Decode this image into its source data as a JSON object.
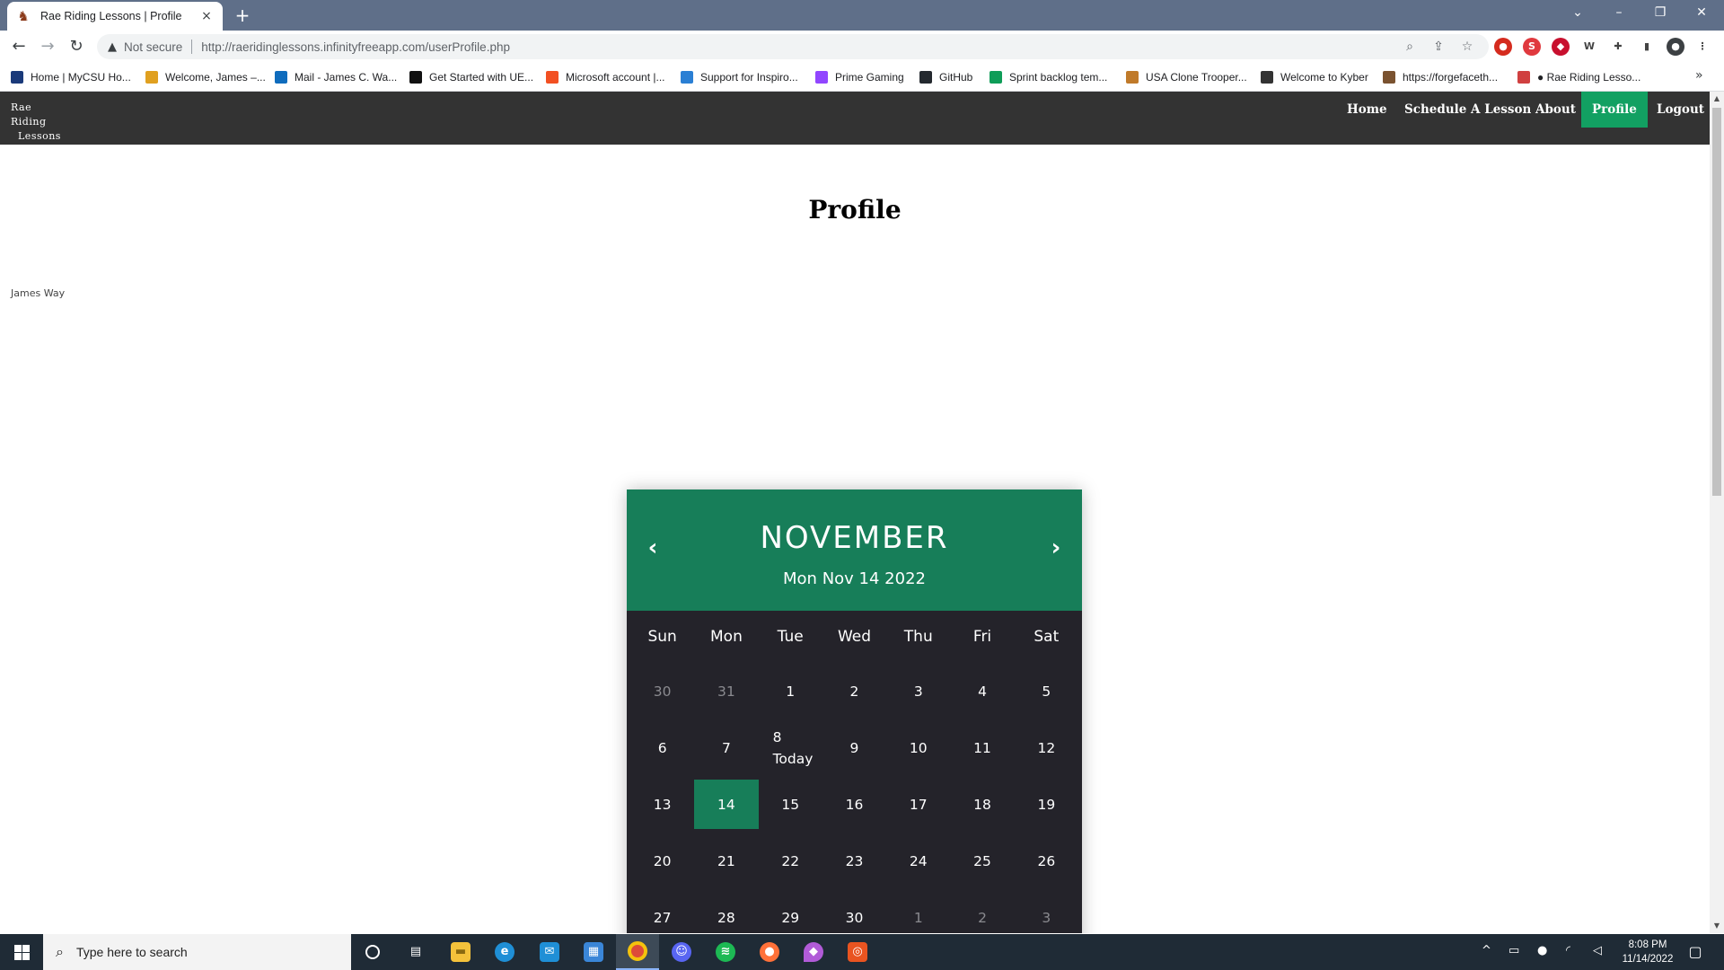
{
  "browser": {
    "tab_title": "Rae Riding Lessons | Profile",
    "tab_close": "×",
    "new_tab": "+",
    "not_secure": "Not secure",
    "url": "http://raeridinglessons.infinityfreeapp.com/userProfile.php",
    "bookmarks": [
      {
        "label": "Home | MyCSU Ho...",
        "icon": "mycsu-icon",
        "color": "#1a3a7a"
      },
      {
        "label": "Welcome, James –...",
        "icon": "pencil-icon",
        "color": "#e0a020"
      },
      {
        "label": "Mail - James C. Wa...",
        "icon": "outlook-icon",
        "color": "#0f6cbd"
      },
      {
        "label": "Get Started with UE...",
        "icon": "unreal-icon",
        "color": "#111111"
      },
      {
        "label": "Microsoft account |...",
        "icon": "microsoft-icon",
        "color": "#f25022"
      },
      {
        "label": "Support for Inspiro...",
        "icon": "dell-icon",
        "color": "#2a7fd4"
      },
      {
        "label": "Prime Gaming",
        "icon": "crown-icon",
        "color": "#9146ff"
      },
      {
        "label": "GitHub",
        "icon": "github-icon",
        "color": "#24292f"
      },
      {
        "label": "Sprint backlog tem...",
        "icon": "sheets-icon",
        "color": "#0f9d58"
      },
      {
        "label": "USA Clone Trooper...",
        "icon": "box-icon",
        "color": "#c07a2a"
      },
      {
        "label": "Welcome to Kyber",
        "icon": "kyber-icon",
        "color": "#333333"
      },
      {
        "label": "https://forgefaceth...",
        "icon": "bird-icon",
        "color": "#7a5230"
      },
      {
        "label": "● Rae Riding Lesso...",
        "icon": "dots-icon",
        "color": "#d04040"
      }
    ]
  },
  "site": {
    "logo_line1": "Rae Riding",
    "logo_line2": "Lessons",
    "nav": [
      {
        "label": "Home",
        "active": false
      },
      {
        "label": "Schedule A Lesson",
        "active": false
      },
      {
        "label": "About",
        "active": false
      },
      {
        "label": "Profile",
        "active": true
      },
      {
        "label": "Logout",
        "active": false
      }
    ]
  },
  "page": {
    "title": "Profile",
    "user_name": "James Way"
  },
  "calendar": {
    "month": "NOVEMBER",
    "date_line": "Mon Nov 14 2022",
    "prev_arrow": "‹",
    "next_arrow": "›",
    "weekdays": [
      "Sun",
      "Mon",
      "Tue",
      "Wed",
      "Thu",
      "Fri",
      "Sat"
    ],
    "today_label": "Today",
    "weeks": [
      [
        {
          "d": "30",
          "m": true
        },
        {
          "d": "31",
          "m": true
        },
        {
          "d": "1"
        },
        {
          "d": "2"
        },
        {
          "d": "3"
        },
        {
          "d": "4"
        },
        {
          "d": "5"
        }
      ],
      [
        {
          "d": "6"
        },
        {
          "d": "7"
        },
        {
          "d": "8",
          "today": true
        },
        {
          "d": "9"
        },
        {
          "d": "10"
        },
        {
          "d": "11"
        },
        {
          "d": "12"
        }
      ],
      [
        {
          "d": "13"
        },
        {
          "d": "14",
          "sel": true
        },
        {
          "d": "15"
        },
        {
          "d": "16"
        },
        {
          "d": "17"
        },
        {
          "d": "18"
        },
        {
          "d": "19"
        }
      ],
      [
        {
          "d": "20"
        },
        {
          "d": "21"
        },
        {
          "d": "22"
        },
        {
          "d": "23"
        },
        {
          "d": "24"
        },
        {
          "d": "25"
        },
        {
          "d": "26"
        }
      ],
      [
        {
          "d": "27"
        },
        {
          "d": "28"
        },
        {
          "d": "29"
        },
        {
          "d": "30"
        },
        {
          "d": "1",
          "m": true
        },
        {
          "d": "2",
          "m": true
        },
        {
          "d": "3",
          "m": true
        }
      ]
    ],
    "accent_color": "#177e59"
  },
  "taskbar": {
    "search_placeholder": "Type here to search",
    "time": "8:08 PM",
    "date": "11/14/2022"
  }
}
